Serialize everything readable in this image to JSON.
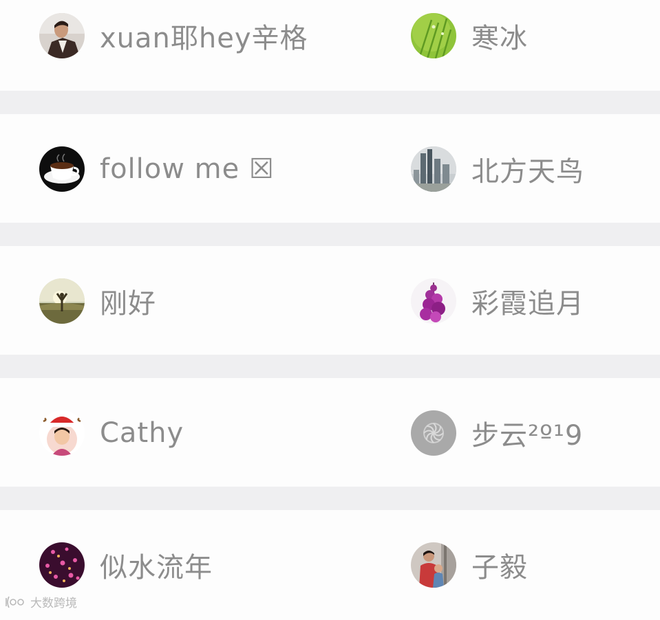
{
  "contacts": [
    {
      "left": {
        "name": "xuan耶hey辛格",
        "avatar": "man-in-suit-photo"
      },
      "right": {
        "name": "寒冰",
        "avatar": "green-grass-photo"
      }
    },
    {
      "left": {
        "name": "follow me ☒",
        "avatar": "coffee-cup-photo"
      },
      "right": {
        "name": "北方天鸟",
        "avatar": "city-skyline-photo"
      }
    },
    {
      "left": {
        "name": "刚好",
        "avatar": "sunset-person-photo"
      },
      "right": {
        "name": "彩霞追月",
        "avatar": "purple-flower-photo"
      }
    },
    {
      "left": {
        "name": "Cathy",
        "avatar": "child-christmas-hat-photo"
      },
      "right": {
        "name": "步云²º¹9",
        "avatar": "gray-logo"
      }
    },
    {
      "left": {
        "name": "似水流年",
        "avatar": "purple-flowers-photo"
      },
      "right": {
        "name": "子毅",
        "avatar": "family-photo"
      }
    }
  ],
  "watermark": {
    "text": "大数跨境",
    "icon": "bigdata-logo-icon"
  },
  "colors": {
    "separator": "#efeff1",
    "name_text": "#8c8c8c",
    "row_bg": "#fdfdfd"
  }
}
